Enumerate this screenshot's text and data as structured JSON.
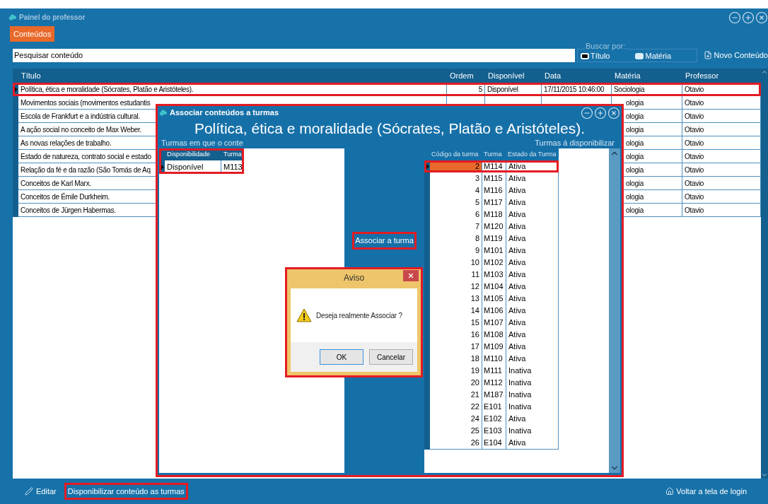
{
  "window": {
    "title": "Painel do professor"
  },
  "tabs": [
    {
      "label": "Conteúdos",
      "selected": true
    }
  ],
  "search": {
    "value": "Pesquisar conteúdo"
  },
  "search_by": {
    "label": "Buscar por:",
    "options": [
      {
        "label": "Título",
        "selected": true
      },
      {
        "label": "Matéria",
        "selected": false
      }
    ]
  },
  "new_button": "Novo Conteúdo",
  "table": {
    "columns": [
      "Título",
      "Ordem",
      "Disponível",
      "Data",
      "Matéria",
      "Professor"
    ],
    "rows": [
      {
        "kind": "full",
        "selected": true,
        "highlighted": true,
        "cells": [
          "Política, ética e moralidade (Sócrates, Platão e Aristóteles).",
          "5",
          "Disponível",
          "17/11/2015 10:46:00",
          "Sociologia",
          "Otavio"
        ]
      },
      {
        "kind": "covered",
        "selected": false,
        "highlighted": false,
        "cells": [
          "Movimentos sociais (movimentos estudantis",
          "ologia",
          "Otavio"
        ]
      },
      {
        "kind": "covered",
        "selected": false,
        "highlighted": false,
        "cells": [
          "Escola de Frankfurt e a indústria cultural.",
          "ologia",
          "Otavio"
        ]
      },
      {
        "kind": "covered",
        "selected": false,
        "highlighted": false,
        "cells": [
          "A ação social no conceito de Max Weber.",
          "ologia",
          "Otavio"
        ]
      },
      {
        "kind": "covered",
        "selected": false,
        "highlighted": false,
        "cells": [
          "As novas relações de trabalho.",
          "ologia",
          "Otavio"
        ]
      },
      {
        "kind": "covered",
        "selected": false,
        "highlighted": false,
        "cells": [
          "Estado de natureza, contrato social e estado",
          "ologia",
          "Otavio"
        ]
      },
      {
        "kind": "covered",
        "selected": false,
        "highlighted": false,
        "cells": [
          "Relação da fé e da razão (São Tomás de Aq",
          "ologia",
          "Otavio"
        ]
      },
      {
        "kind": "covered",
        "selected": false,
        "highlighted": false,
        "cells": [
          "Conceitos de Karl Marx.",
          "ologia",
          "Otavio"
        ]
      },
      {
        "kind": "covered",
        "selected": false,
        "highlighted": false,
        "cells": [
          "Conceitos de Émile Durkheim.",
          "ologia",
          "Otavio"
        ]
      },
      {
        "kind": "covered",
        "selected": false,
        "highlighted": false,
        "cells": [
          "Conceitos de Jürgen Habermas.",
          "ologia",
          "Otavio"
        ]
      }
    ]
  },
  "actions": [
    {
      "label": "Editar",
      "highlighted": false
    },
    {
      "label": "Disponibilizar conteúdo as turmas",
      "highlighted": true
    }
  ],
  "back_link": "Voltar a tela de login",
  "dialog": {
    "title": "Associar conteúdos a turmas",
    "highlighted": true,
    "heading": "Política, ética e moralidade (Sócrates, Platão e Aristóteles).",
    "left_label": "Turmas em que o conte",
    "right_label": "Turmas á disponibilizar",
    "assigned": {
      "highlighted": true,
      "columns": [
        "Disponibilidade",
        "Turma"
      ],
      "rows": [
        {
          "selected": true,
          "cells": [
            "Disponível",
            "M113"
          ]
        }
      ]
    },
    "associate_button": {
      "label": "Associar a turma",
      "highlighted": true
    },
    "available": {
      "columns": [
        "Código da turma",
        "Turma",
        "Estado da Turma"
      ],
      "rows": [
        {
          "selected": true,
          "highlighted": true,
          "cells": [
            "2",
            "M114",
            "Ativa"
          ]
        },
        {
          "selected": false,
          "highlighted": false,
          "cells": [
            "3",
            "M115",
            "Ativa"
          ]
        },
        {
          "selected": false,
          "highlighted": false,
          "cells": [
            "4",
            "M116",
            "Ativa"
          ]
        },
        {
          "selected": false,
          "highlighted": false,
          "cells": [
            "5",
            "M117",
            "Ativa"
          ]
        },
        {
          "selected": false,
          "highlighted": false,
          "cells": [
            "6",
            "M118",
            "Ativa"
          ]
        },
        {
          "selected": false,
          "highlighted": false,
          "cells": [
            "7",
            "M120",
            "Ativa"
          ]
        },
        {
          "selected": false,
          "highlighted": false,
          "cells": [
            "8",
            "M119",
            "Ativa"
          ]
        },
        {
          "selected": false,
          "highlighted": false,
          "cells": [
            "9",
            "M101",
            "Ativa"
          ]
        },
        {
          "selected": false,
          "highlighted": false,
          "cells": [
            "10",
            "M102",
            "Ativa"
          ]
        },
        {
          "selected": false,
          "highlighted": false,
          "cells": [
            "11",
            "M103",
            "Ativa"
          ]
        },
        {
          "selected": false,
          "highlighted": false,
          "cells": [
            "12",
            "M104",
            "Ativa"
          ]
        },
        {
          "selected": false,
          "highlighted": false,
          "cells": [
            "13",
            "M105",
            "Ativa"
          ]
        },
        {
          "selected": false,
          "highlighted": false,
          "cells": [
            "14",
            "M106",
            "Ativa"
          ]
        },
        {
          "selected": false,
          "highlighted": false,
          "cells": [
            "15",
            "M107",
            "Ativa"
          ]
        },
        {
          "selected": false,
          "highlighted": false,
          "cells": [
            "16",
            "M108",
            "Ativa"
          ]
        },
        {
          "selected": false,
          "highlighted": false,
          "cells": [
            "17",
            "M109",
            "Ativa"
          ]
        },
        {
          "selected": false,
          "highlighted": false,
          "cells": [
            "18",
            "M110",
            "Ativa"
          ]
        },
        {
          "selected": false,
          "highlighted": false,
          "cells": [
            "19",
            "M111",
            "Inativa"
          ]
        },
        {
          "selected": false,
          "highlighted": false,
          "cells": [
            "20",
            "M112",
            "Inativa"
          ]
        },
        {
          "selected": false,
          "highlighted": false,
          "cells": [
            "21",
            "M187",
            "Inativa"
          ]
        },
        {
          "selected": false,
          "highlighted": false,
          "cells": [
            "22",
            "E101",
            "Inativa"
          ]
        },
        {
          "selected": false,
          "highlighted": false,
          "cells": [
            "24",
            "E102",
            "Ativa"
          ]
        },
        {
          "selected": false,
          "highlighted": false,
          "cells": [
            "25",
            "E103",
            "Inativa"
          ]
        },
        {
          "selected": false,
          "highlighted": false,
          "cells": [
            "26",
            "E104",
            "Ativa"
          ]
        }
      ]
    }
  },
  "alert": {
    "title": "Aviso",
    "highlighted": true,
    "message": "Deseja realmente Associar ?",
    "buttons": [
      {
        "label": "OK",
        "default": true
      },
      {
        "label": "Cancelar",
        "default": false
      }
    ]
  }
}
